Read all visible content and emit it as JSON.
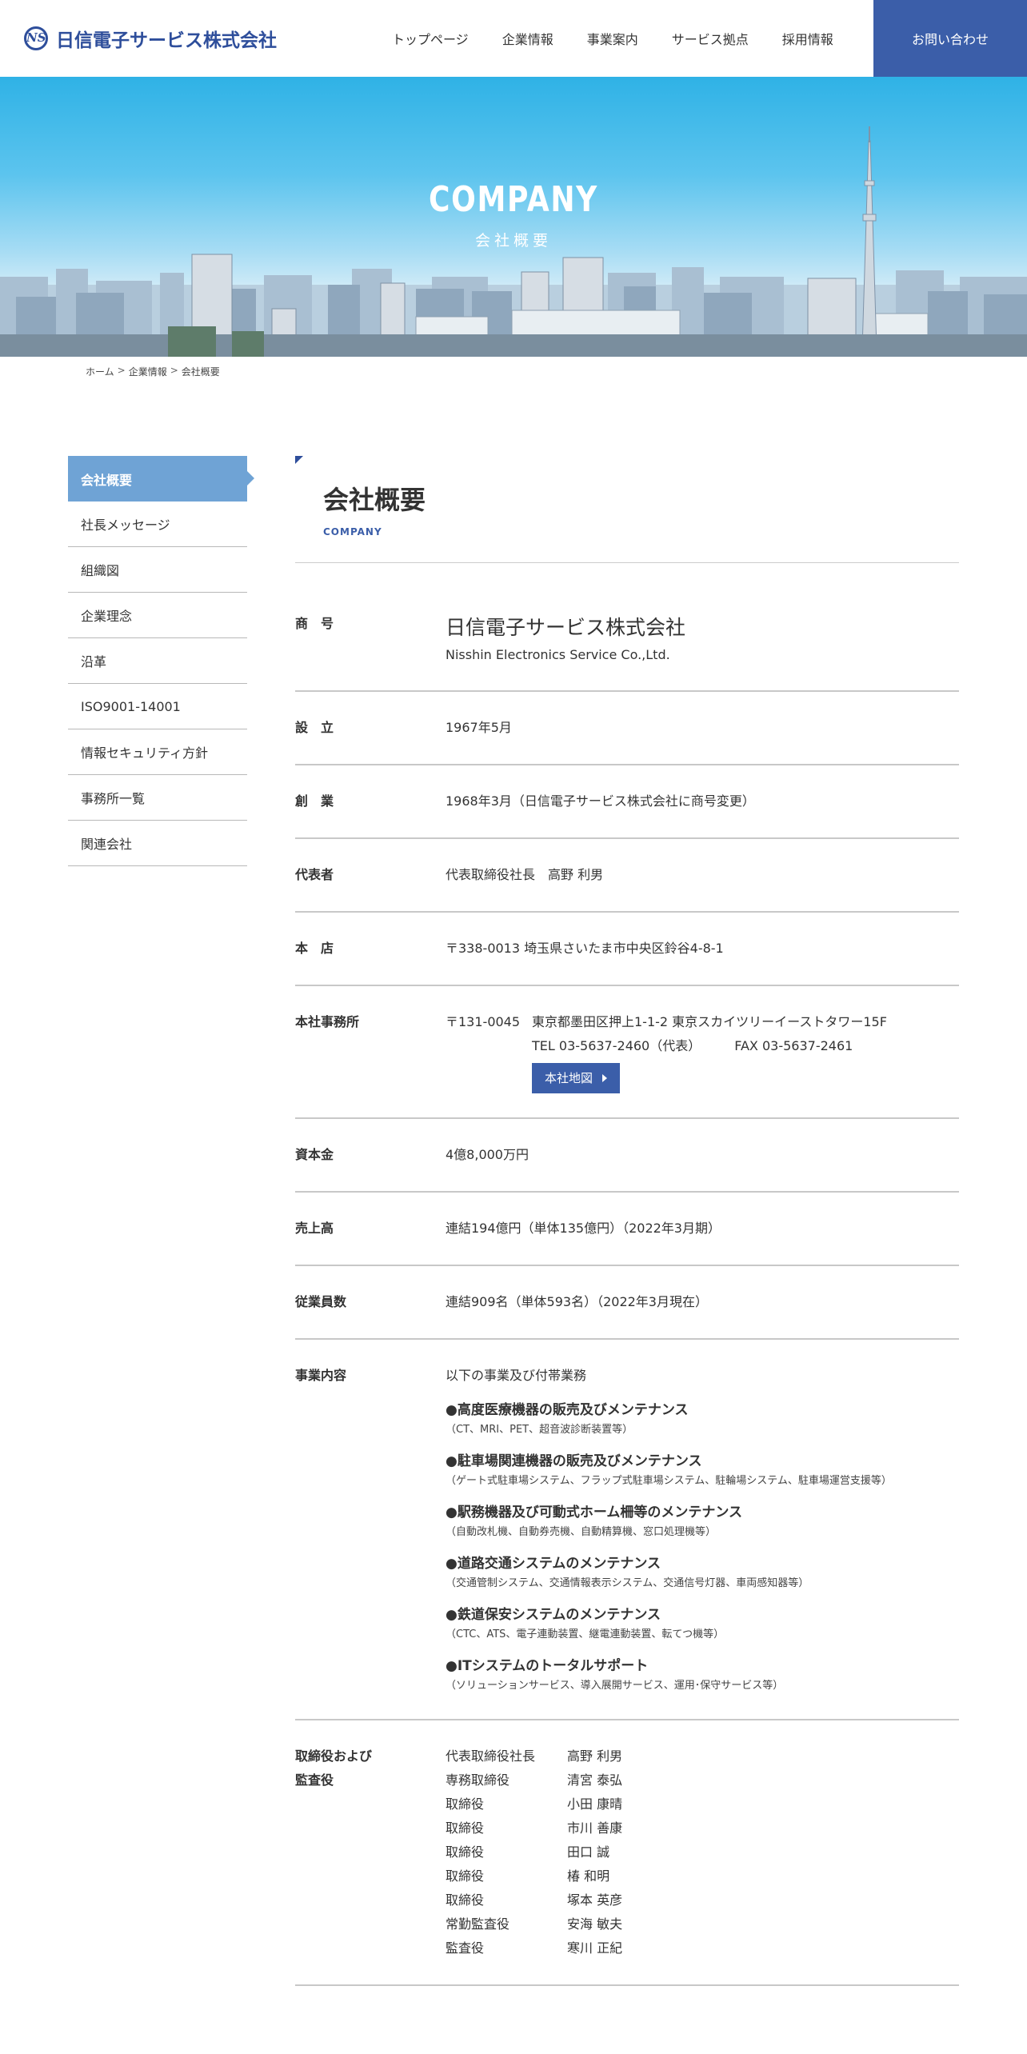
{
  "header": {
    "logo_mark": "NS",
    "logo_text": "日信電子サービス株式会社",
    "nav": [
      "トップページ",
      "企業情報",
      "事業案内",
      "サービス拠点",
      "採用情報"
    ],
    "contact": "お問い合わせ"
  },
  "hero": {
    "title": "COMPANY",
    "subtitle": "会社概要"
  },
  "breadcrumb": [
    "ホーム",
    "企業情報",
    "会社概要"
  ],
  "breadcrumb_sep": ">",
  "side_menu": [
    "会社概要",
    "社長メッセージ",
    "組織図",
    "企業理念",
    "沿革",
    "ISO9001-14001",
    "情報セキュリティ方針",
    "事務所一覧",
    "関連会社"
  ],
  "main": {
    "title": "会社概要",
    "title_en": "COMPANY",
    "rows": {
      "name": {
        "label": "商　号",
        "value": "日信電子サービス株式会社",
        "value_en": "Nisshin Electronics Service Co.,Ltd."
      },
      "established": {
        "label": "設　立",
        "value": "1967年5月"
      },
      "founded": {
        "label": "創　業",
        "value": "1968年3月（日信電子サービス株式会社に商号変更）"
      },
      "representative": {
        "label": "代表者",
        "value": "代表取締役社長　高野 利男"
      },
      "head_office": {
        "label": "本　店",
        "value": "〒338-0013 埼玉県さいたま市中央区鈴谷4-8-1"
      },
      "office": {
        "label": "本社事務所",
        "zip": "〒131-0045",
        "address": "東京都墨田区押上1-1-2 東京スカイツリーイーストタワー15F",
        "tel": "TEL 03-5637-2460（代表）",
        "fax": "FAX 03-5637-2461",
        "map_button": "本社地図"
      },
      "capital": {
        "label": "資本金",
        "value": "4億8,000万円"
      },
      "sales": {
        "label": "売上高",
        "value": "連結194億円（単体135億円）（2022年3月期）"
      },
      "employees": {
        "label": "従業員数",
        "value": "連結909名（単体593名）（2022年3月現在）"
      },
      "business": {
        "label": "事業内容",
        "intro": "以下の事業及び付帯業務",
        "items": [
          {
            "head": "●高度医療機器の販売及びメンテナンス",
            "note": "（CT、MRI、PET、超音波診断装置等）"
          },
          {
            "head": "●駐車場関連機器の販売及びメンテナンス",
            "note": "（ゲート式駐車場システム、フラップ式駐車場システム、駐輪場システム、駐車場運営支援等）"
          },
          {
            "head": "●駅務機器及び可動式ホーム柵等のメンテナンス",
            "note": "（自動改札機、自動券売機、自動精算機、窓口処理機等）"
          },
          {
            "head": "●道路交通システムのメンテナンス",
            "note": "（交通管制システム、交通情報表示システム、交通信号灯器、車両感知器等）"
          },
          {
            "head": "●鉄道保安システムのメンテナンス",
            "note": "（CTC、ATS、電子連動装置、継電連動装置、転てつ機等）"
          },
          {
            "head": "●ITシステムのトータルサポート",
            "note": "（ソリューションサービス、導入展開サービス、運用･保守サービス等）"
          }
        ]
      },
      "officers": {
        "label_line1": "取締役および",
        "label_line2": "監査役",
        "list": [
          {
            "title": "代表取締役社長",
            "name": "高野 利男"
          },
          {
            "title": "専務取締役",
            "name": "清宮 泰弘"
          },
          {
            "title": "取締役",
            "name": "小田 康晴"
          },
          {
            "title": "取締役",
            "name": "市川 善康"
          },
          {
            "title": "取締役",
            "name": "田口 誠"
          },
          {
            "title": "取締役",
            "name": "椿 和明"
          },
          {
            "title": "取締役",
            "name": "塚本 英彦"
          },
          {
            "title": "常勤監査役",
            "name": "安海 敏夫"
          },
          {
            "title": "監査役",
            "name": "寒川 正紀"
          }
        ]
      }
    }
  },
  "colors": {
    "brand": "#2e4e9b",
    "button": "#3b5ea9",
    "side_active": "#6fa3d5",
    "rule": "#c8c8c8"
  }
}
